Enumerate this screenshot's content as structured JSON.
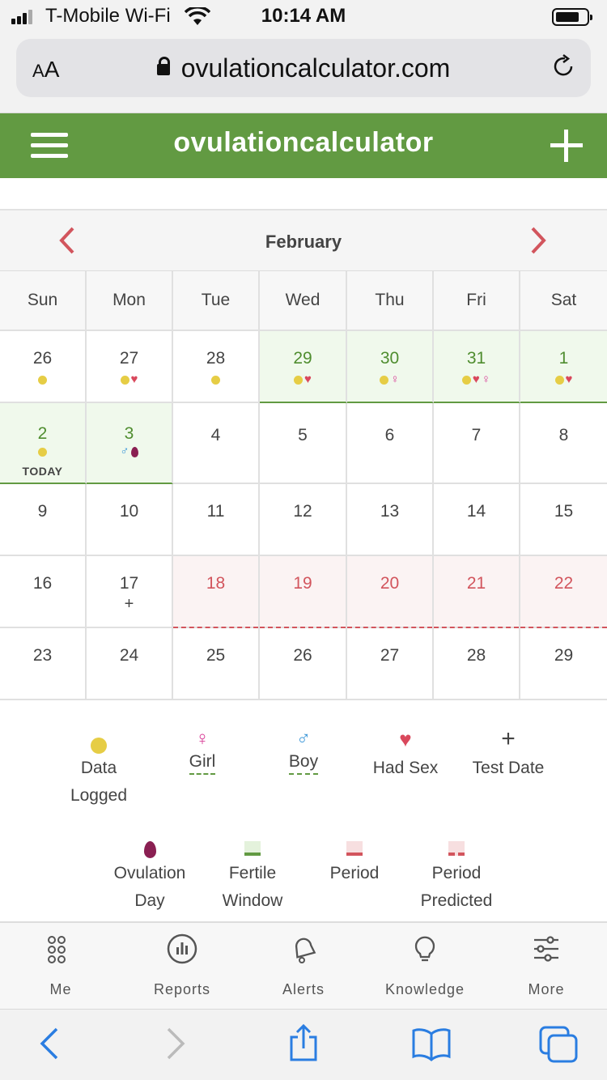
{
  "status_bar": {
    "carrier": "T-Mobile Wi-Fi",
    "time": "10:14 AM"
  },
  "browser": {
    "text_size_label_small": "A",
    "text_size_label_large": "A",
    "url": "ovulationcalculator.com"
  },
  "header": {
    "title": "ovulationcalculator"
  },
  "calendar": {
    "month": "February",
    "weekdays": [
      "Sun",
      "Mon",
      "Tue",
      "Wed",
      "Thu",
      "Fri",
      "Sat"
    ],
    "today_label": "TODAY",
    "weeks": [
      [
        {
          "day": "26",
          "marks": [
            "dot"
          ]
        },
        {
          "day": "27",
          "marks": [
            "dot",
            "heart"
          ]
        },
        {
          "day": "28",
          "marks": [
            "dot"
          ]
        },
        {
          "day": "29",
          "marks": [
            "dot",
            "heart"
          ],
          "state": "fertile"
        },
        {
          "day": "30",
          "marks": [
            "dot",
            "venus"
          ],
          "state": "fertile"
        },
        {
          "day": "31",
          "marks": [
            "dot",
            "heart",
            "venus"
          ],
          "state": "fertile"
        },
        {
          "day": "1",
          "marks": [
            "dot",
            "heart"
          ],
          "state": "fertile"
        }
      ],
      [
        {
          "day": "2",
          "marks": [
            "dot"
          ],
          "state": "fertile",
          "today": true
        },
        {
          "day": "3",
          "marks": [
            "mars",
            "drop"
          ],
          "state": "fertile"
        },
        {
          "day": "4",
          "marks": []
        },
        {
          "day": "5",
          "marks": []
        },
        {
          "day": "6",
          "marks": []
        },
        {
          "day": "7",
          "marks": []
        },
        {
          "day": "8",
          "marks": []
        }
      ],
      [
        {
          "day": "9",
          "marks": []
        },
        {
          "day": "10",
          "marks": []
        },
        {
          "day": "11",
          "marks": []
        },
        {
          "day": "12",
          "marks": []
        },
        {
          "day": "13",
          "marks": []
        },
        {
          "day": "14",
          "marks": []
        },
        {
          "day": "15",
          "marks": []
        }
      ],
      [
        {
          "day": "16",
          "marks": []
        },
        {
          "day": "17",
          "marks": [
            "plus"
          ]
        },
        {
          "day": "18",
          "marks": [],
          "state": "predicted"
        },
        {
          "day": "19",
          "marks": [],
          "state": "predicted"
        },
        {
          "day": "20",
          "marks": [],
          "state": "predicted"
        },
        {
          "day": "21",
          "marks": [],
          "state": "predicted"
        },
        {
          "day": "22",
          "marks": [],
          "state": "predicted"
        }
      ],
      [
        {
          "day": "23",
          "marks": []
        },
        {
          "day": "24",
          "marks": []
        },
        {
          "day": "25",
          "marks": []
        },
        {
          "day": "26",
          "marks": []
        },
        {
          "day": "27",
          "marks": []
        },
        {
          "day": "28",
          "marks": []
        },
        {
          "day": "29",
          "marks": []
        }
      ]
    ]
  },
  "legend": {
    "data_logged": [
      "Data",
      "Logged"
    ],
    "girl": "Girl",
    "boy": "Boy",
    "had_sex": "Had Sex",
    "test_date": "Test Date",
    "ovulation_day": [
      "Ovulation",
      "Day"
    ],
    "fertile_window": [
      "Fertile",
      "Window"
    ],
    "period": "Period",
    "period_predicted": [
      "Period",
      "Predicted"
    ]
  },
  "tabbar": {
    "items": [
      {
        "label": "Me",
        "icon": "dots-grid-icon"
      },
      {
        "label": "Reports",
        "icon": "chart-icon"
      },
      {
        "label": "Alerts",
        "icon": "bell-icon"
      },
      {
        "label": "Knowledge",
        "icon": "lightbulb-icon"
      },
      {
        "label": "More",
        "icon": "sliders-icon"
      }
    ]
  },
  "colors": {
    "brand_green": "#629a42",
    "fertile_bg": "#f0f9ec",
    "period_red": "#d2555d",
    "period_bg": "#fbf3f3",
    "data_dot": "#e6cd45",
    "heart": "#d9485c",
    "girl": "#d83c96",
    "boy": "#3c97d8",
    "ovulation": "#8a1f52",
    "ios_blue": "#2a7de1"
  }
}
